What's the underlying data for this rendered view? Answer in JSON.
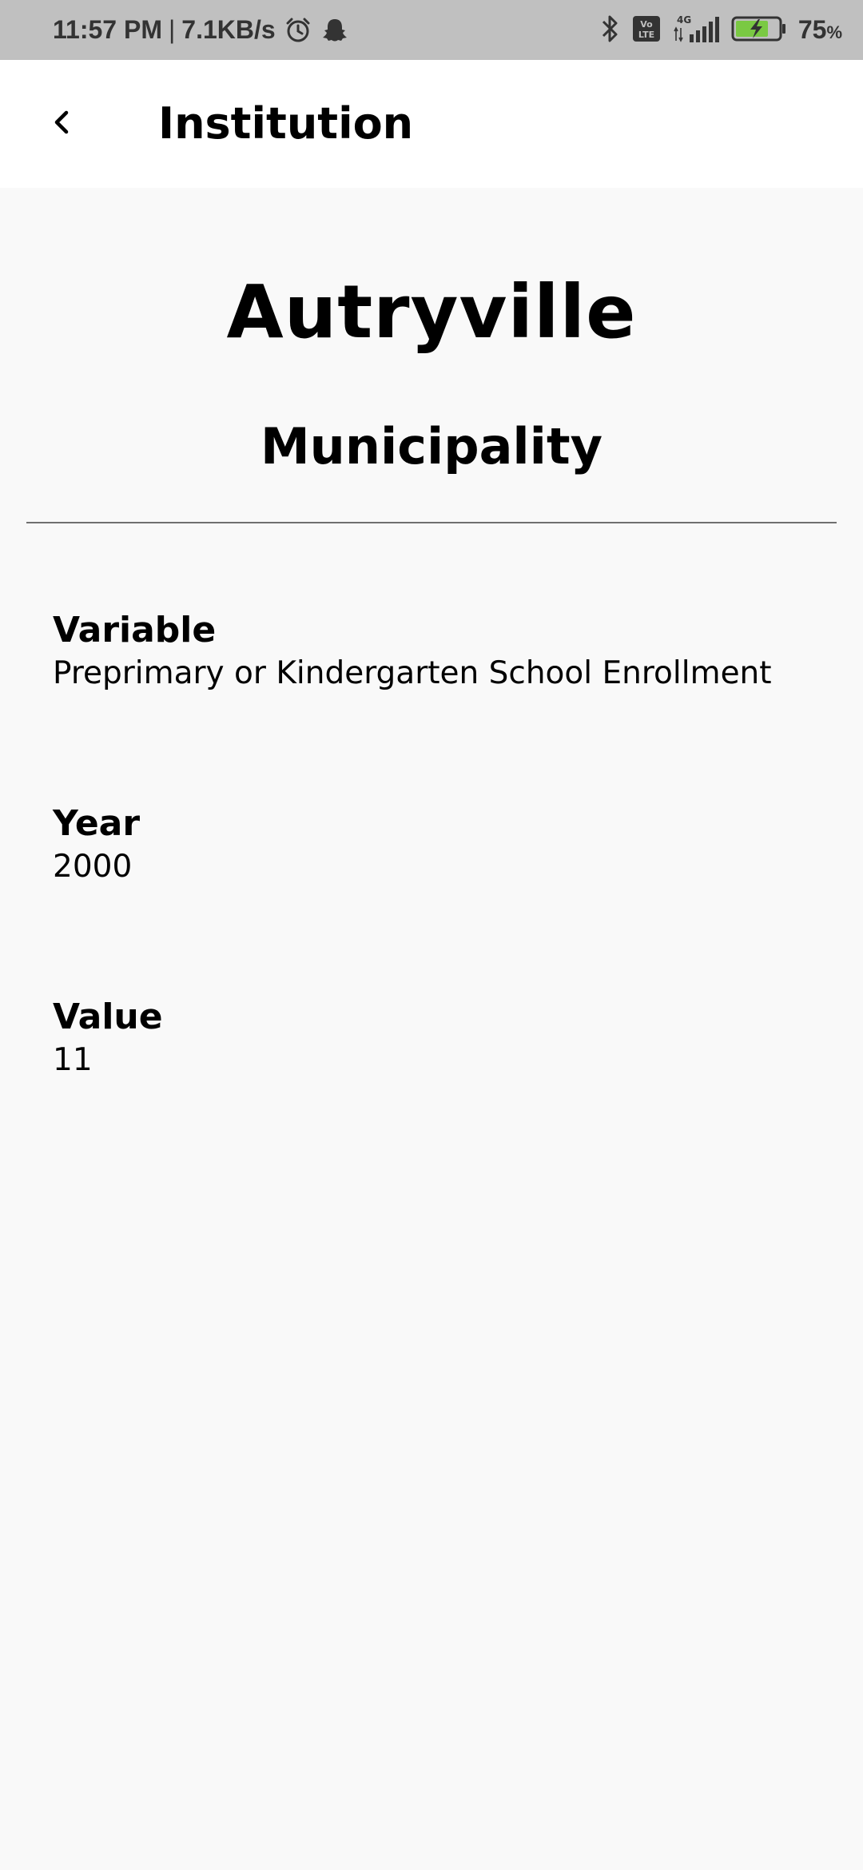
{
  "status_bar": {
    "time": "11:57 PM",
    "separator": "|",
    "network_speed": "7.1KB/s",
    "battery_percent": "75",
    "battery_unit": "%",
    "network_label": "4G",
    "volte_label": "Vo LTE",
    "icons": [
      "alarm-icon",
      "snapchat-icon",
      "bluetooth-icon",
      "volte-icon",
      "signal-icon",
      "battery-charging-icon"
    ]
  },
  "app_bar": {
    "title": "Institution",
    "back_icon": "chevron-left-icon"
  },
  "header": {
    "name": "Autryville",
    "type": "Municipality"
  },
  "fields": [
    {
      "label": "Variable",
      "value": "Preprimary or Kindergarten School Enrollment"
    },
    {
      "label": "Year",
      "value": "2000"
    },
    {
      "label": "Value",
      "value": "11"
    }
  ],
  "colors": {
    "status_bar_bg": "#c0c0c0",
    "app_bar_bg": "#ffffff",
    "page_bg": "#f9f9f9",
    "battery_fill": "#7ac943"
  }
}
